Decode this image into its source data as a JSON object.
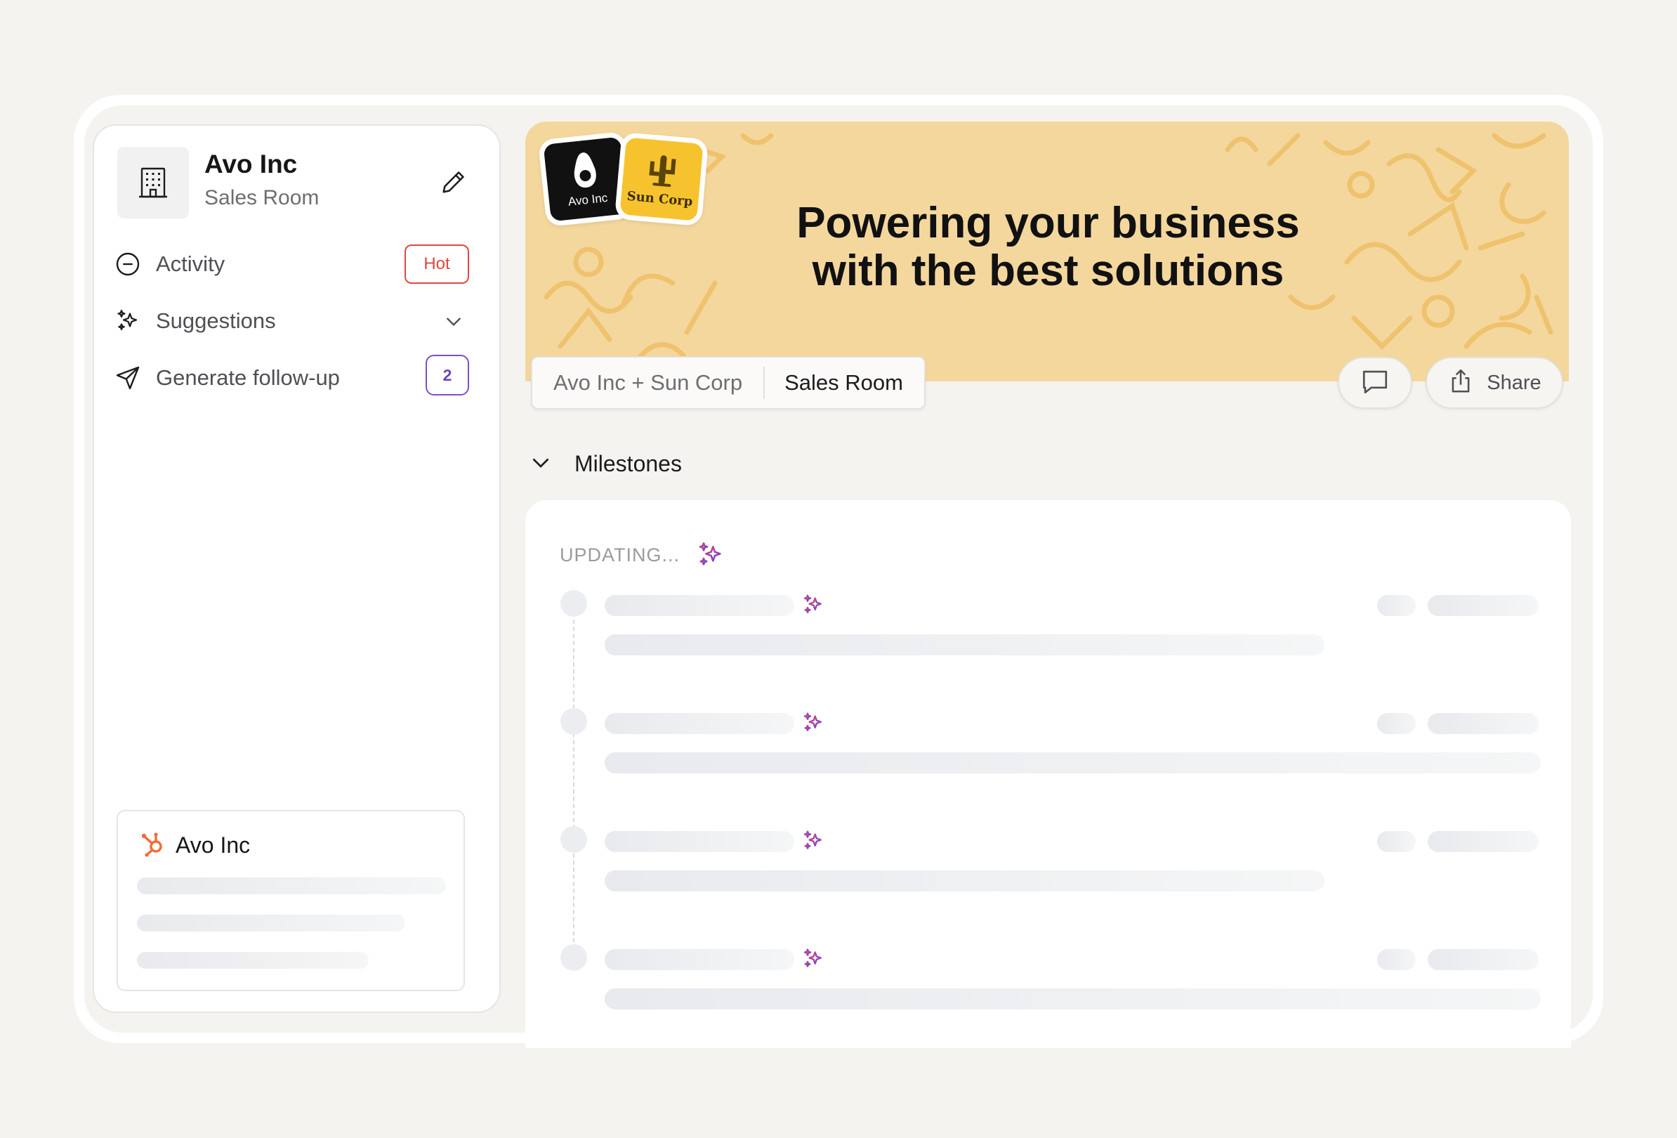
{
  "company": {
    "name": "Avo Inc",
    "subtitle": "Sales Room"
  },
  "nav": {
    "activity": {
      "label": "Activity",
      "badge": "Hot"
    },
    "suggestions": {
      "label": "Suggestions"
    },
    "followup": {
      "label": "Generate follow-up",
      "count": "2"
    }
  },
  "crm": {
    "name": "Avo Inc"
  },
  "banner": {
    "headline_line1": "Powering your business",
    "headline_line2": "with the best solutions",
    "logo_left": "Avo Inc",
    "logo_right": "Sun Corp"
  },
  "breadcrumb": {
    "parent": "Avo Inc + Sun Corp",
    "current": "Sales Room"
  },
  "actions": {
    "share": "Share"
  },
  "milestones": {
    "title": "Milestones",
    "status": "UPDATING..."
  },
  "colors": {
    "accent_red": "#e1473e",
    "accent_purple": "#7c4fc4",
    "banner_bg": "#f4d79d",
    "sun_yellow": "#f6c32e"
  },
  "icons": [
    "building-icon",
    "pencil-icon",
    "minus-circle-icon",
    "sparkles-icon",
    "chevron-down-icon",
    "send-icon",
    "hubspot-icon",
    "comment-icon",
    "share-icon"
  ]
}
